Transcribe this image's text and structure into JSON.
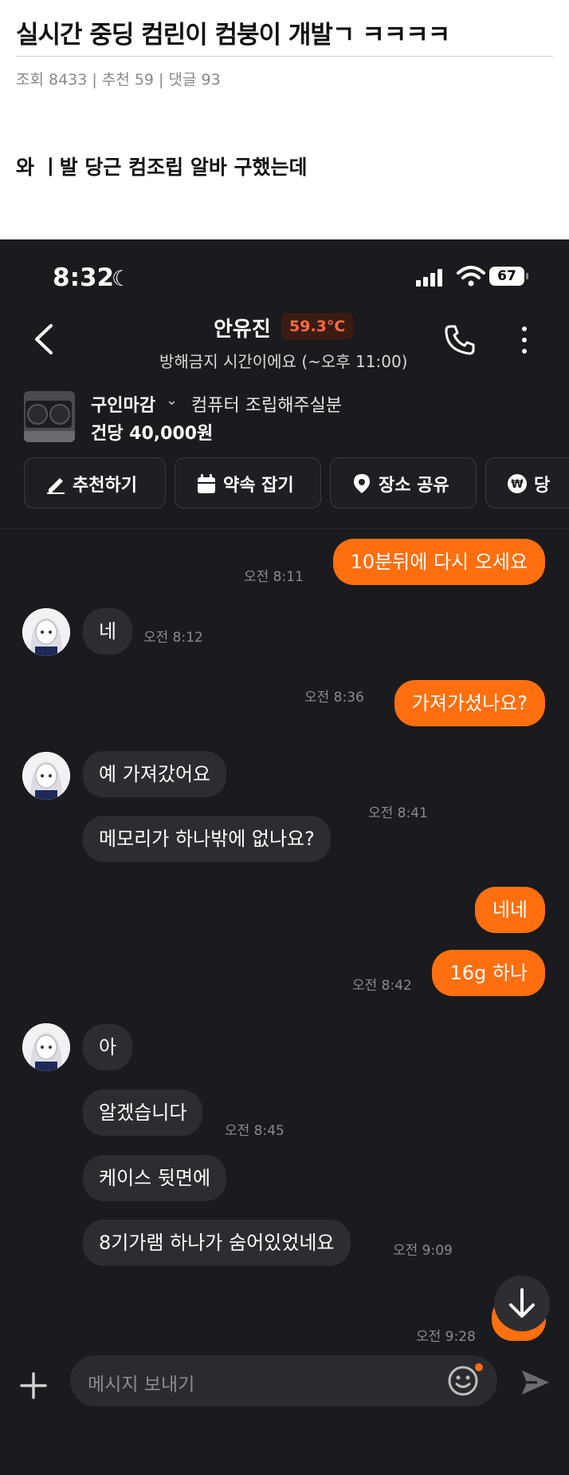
{
  "post": {
    "title": "실시간 중딩 컴린이 컴붕이 개발ㄱ ㅋㅋㅋㅋ",
    "meta": "조회 8433 | 추천 59 | 댓글 93",
    "body": "와 ㅣ발 당근 컴조립 알바 구했는데"
  },
  "status_bar": {
    "time": "8:32",
    "battery": "67"
  },
  "header": {
    "name": "안유진",
    "temperature": "59.3°C",
    "subtitle": "방해금지 시간이에요 (~오후 11:00)"
  },
  "product": {
    "status": "구인마감",
    "name": "컴퓨터 조립해주실분",
    "price": "건당 40,000원"
  },
  "actions": [
    {
      "label": "추천하기"
    },
    {
      "label": "약속 잡기"
    },
    {
      "label": "장소 공유"
    },
    {
      "label": "당"
    }
  ],
  "messages": [
    {
      "from": "me",
      "text": "10분뒤에 다시 오세요",
      "time": "오전 8:11"
    },
    {
      "from": "them",
      "text": "네",
      "time": "오전 8:12"
    },
    {
      "from": "me",
      "text": "가져가셨나요?",
      "time": "오전 8:36"
    },
    {
      "from": "them",
      "text": "예 가져갔어요",
      "time": ""
    },
    {
      "from": "them",
      "text": "메모리가 하나밖에 없나요?",
      "time": "오전 8:41"
    },
    {
      "from": "me",
      "text": "네네",
      "time": ""
    },
    {
      "from": "me",
      "text": "16g 하나",
      "time": "오전 8:42"
    },
    {
      "from": "them",
      "text": "아",
      "time": ""
    },
    {
      "from": "them",
      "text": "알겠습니다",
      "time": "오전 8:45"
    },
    {
      "from": "them",
      "text": "케이스 뒷면에",
      "time": ""
    },
    {
      "from": "them",
      "text": "8기가램 하나가 숨어있었네요",
      "time": "오전 9:09"
    },
    {
      "from": "me",
      "text": "",
      "time": "오전 9:28"
    }
  ],
  "composer": {
    "placeholder": "메시지 보내기"
  },
  "colors": {
    "accent": "#ff6f0f",
    "background": "#1a1b1e",
    "bubble_in": "#2c2d31",
    "temperature": "#ff6a3d"
  }
}
